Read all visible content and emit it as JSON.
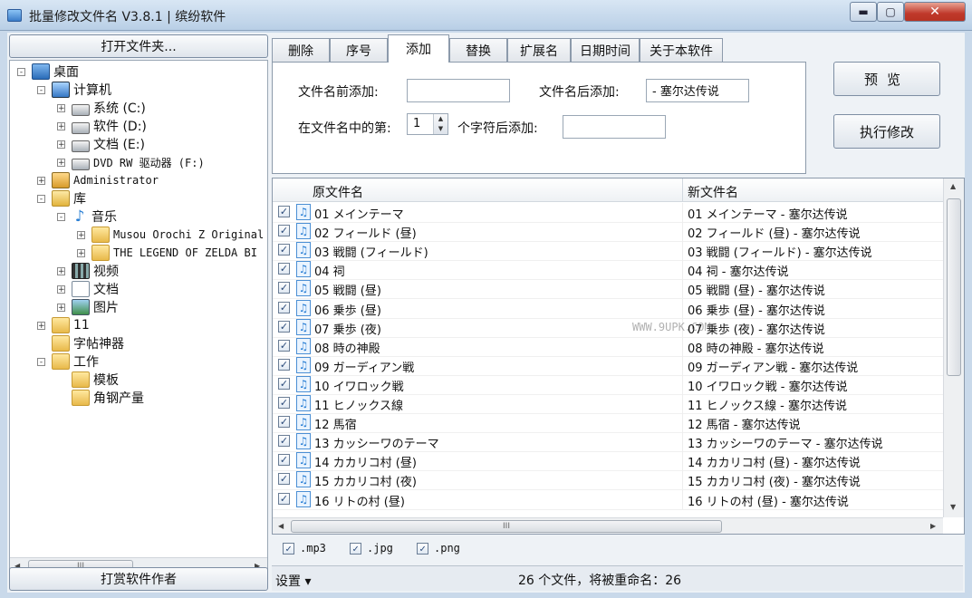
{
  "window": {
    "title": "批量修改文件名 V3.8.1 | 缤纷软件",
    "minimize": "▬",
    "maximize": "▢",
    "close": "✕"
  },
  "left": {
    "open_folder": "打开文件夹...",
    "reward": "打赏软件作者",
    "tree": [
      {
        "label": "桌面",
        "icon": "desktop-icon"
      },
      {
        "label": "计算机",
        "icon": "computer-icon"
      },
      {
        "label": "系统 (C:)",
        "icon": "drive-icon"
      },
      {
        "label": "软件 (D:)",
        "icon": "drive-icon"
      },
      {
        "label": "文档 (E:)",
        "icon": "drive-icon"
      },
      {
        "label": "DVD RW 驱动器 (F:)",
        "icon": "dvd-drive-icon"
      },
      {
        "label": "Administrator",
        "icon": "user-folder-icon"
      },
      {
        "label": "库",
        "icon": "library-icon"
      },
      {
        "label": "音乐",
        "icon": "music-icon"
      },
      {
        "label": "Musou Orochi Z Original",
        "icon": "folder-icon"
      },
      {
        "label": "THE LEGEND OF ZELDA BI",
        "icon": "folder-icon"
      },
      {
        "label": "视频",
        "icon": "video-icon"
      },
      {
        "label": "文档",
        "icon": "document-icon"
      },
      {
        "label": "图片",
        "icon": "picture-icon"
      },
      {
        "label": "11",
        "icon": "folder-icon"
      },
      {
        "label": "字帖神器",
        "icon": "folder-icon"
      },
      {
        "label": "工作",
        "icon": "folder-icon"
      },
      {
        "label": "模板",
        "icon": "folder-icon"
      },
      {
        "label": "角钢产量",
        "icon": "folder-icon"
      }
    ],
    "hscroll_grip": "III"
  },
  "tabs": [
    "删除",
    "序号",
    "添加",
    "替换",
    "扩展名",
    "日期时间",
    "关于本软件"
  ],
  "active_tab": 2,
  "add_tab": {
    "prefix_label": "文件名前添加:",
    "prefix_value": "",
    "suffix_label": "文件名后添加:",
    "suffix_value": "- 塞尔达传说",
    "position_label": "在文件名中的第:",
    "position_value": "1",
    "after_label": "个字符后添加:",
    "after_value": ""
  },
  "buttons": {
    "preview": "预览",
    "execute": "执行修改"
  },
  "list": {
    "col_original": "原文件名",
    "col_new": "新文件名",
    "rows": [
      {
        "orig": "01 メインテーマ",
        "new": "01 メインテーマ - 塞尔达传说"
      },
      {
        "orig": "02 フィールド (昼)",
        "new": "02 フィールド (昼) - 塞尔达传说"
      },
      {
        "orig": "03 戦闘 (フィールド)",
        "new": "03 戦闘 (フィールド) - 塞尔达传说"
      },
      {
        "orig": "04 祠",
        "new": "04 祠 - 塞尔达传说"
      },
      {
        "orig": "05 戦闘 (昼)",
        "new": "05 戦闘 (昼) - 塞尔达传说"
      },
      {
        "orig": "06 乗歩 (昼)",
        "new": "06 乗歩 (昼) - 塞尔达传说"
      },
      {
        "orig": "07 乗歩 (夜)",
        "new": "07 乗歩 (夜) - 塞尔达传说"
      },
      {
        "orig": "08 時の神殿",
        "new": "08 時の神殿 - 塞尔达传说"
      },
      {
        "orig": "09 ガーディアン戦",
        "new": "09 ガーディアン戦 - 塞尔达传说"
      },
      {
        "orig": "10 イワロック戦",
        "new": "10 イワロック戦 - 塞尔达传说"
      },
      {
        "orig": "11 ヒノックス線",
        "new": "11 ヒノックス線 - 塞尔达传说"
      },
      {
        "orig": "12 馬宿",
        "new": "12 馬宿 - 塞尔达传说"
      },
      {
        "orig": "13 カッシーワのテーマ",
        "new": "13 カッシーワのテーマ - 塞尔达传说"
      },
      {
        "orig": "14 カカリコ村 (昼)",
        "new": "14 カカリコ村 (昼) - 塞尔达传说"
      },
      {
        "orig": "15 カカリコ村 (夜)",
        "new": "15 カカリコ村 (夜) - 塞尔达传说"
      },
      {
        "orig": "16 リトの村 (昼)",
        "new": "16 リトの村 (昼) - 塞尔达传说"
      }
    ],
    "hscroll_grip": "III"
  },
  "filters": [
    ".mp3",
    ".jpg",
    ".png"
  ],
  "status": {
    "settings": "设置 ▾",
    "text": "26 个文件，将被重命名：26"
  },
  "watermark": "WWW.9UPK.COM"
}
